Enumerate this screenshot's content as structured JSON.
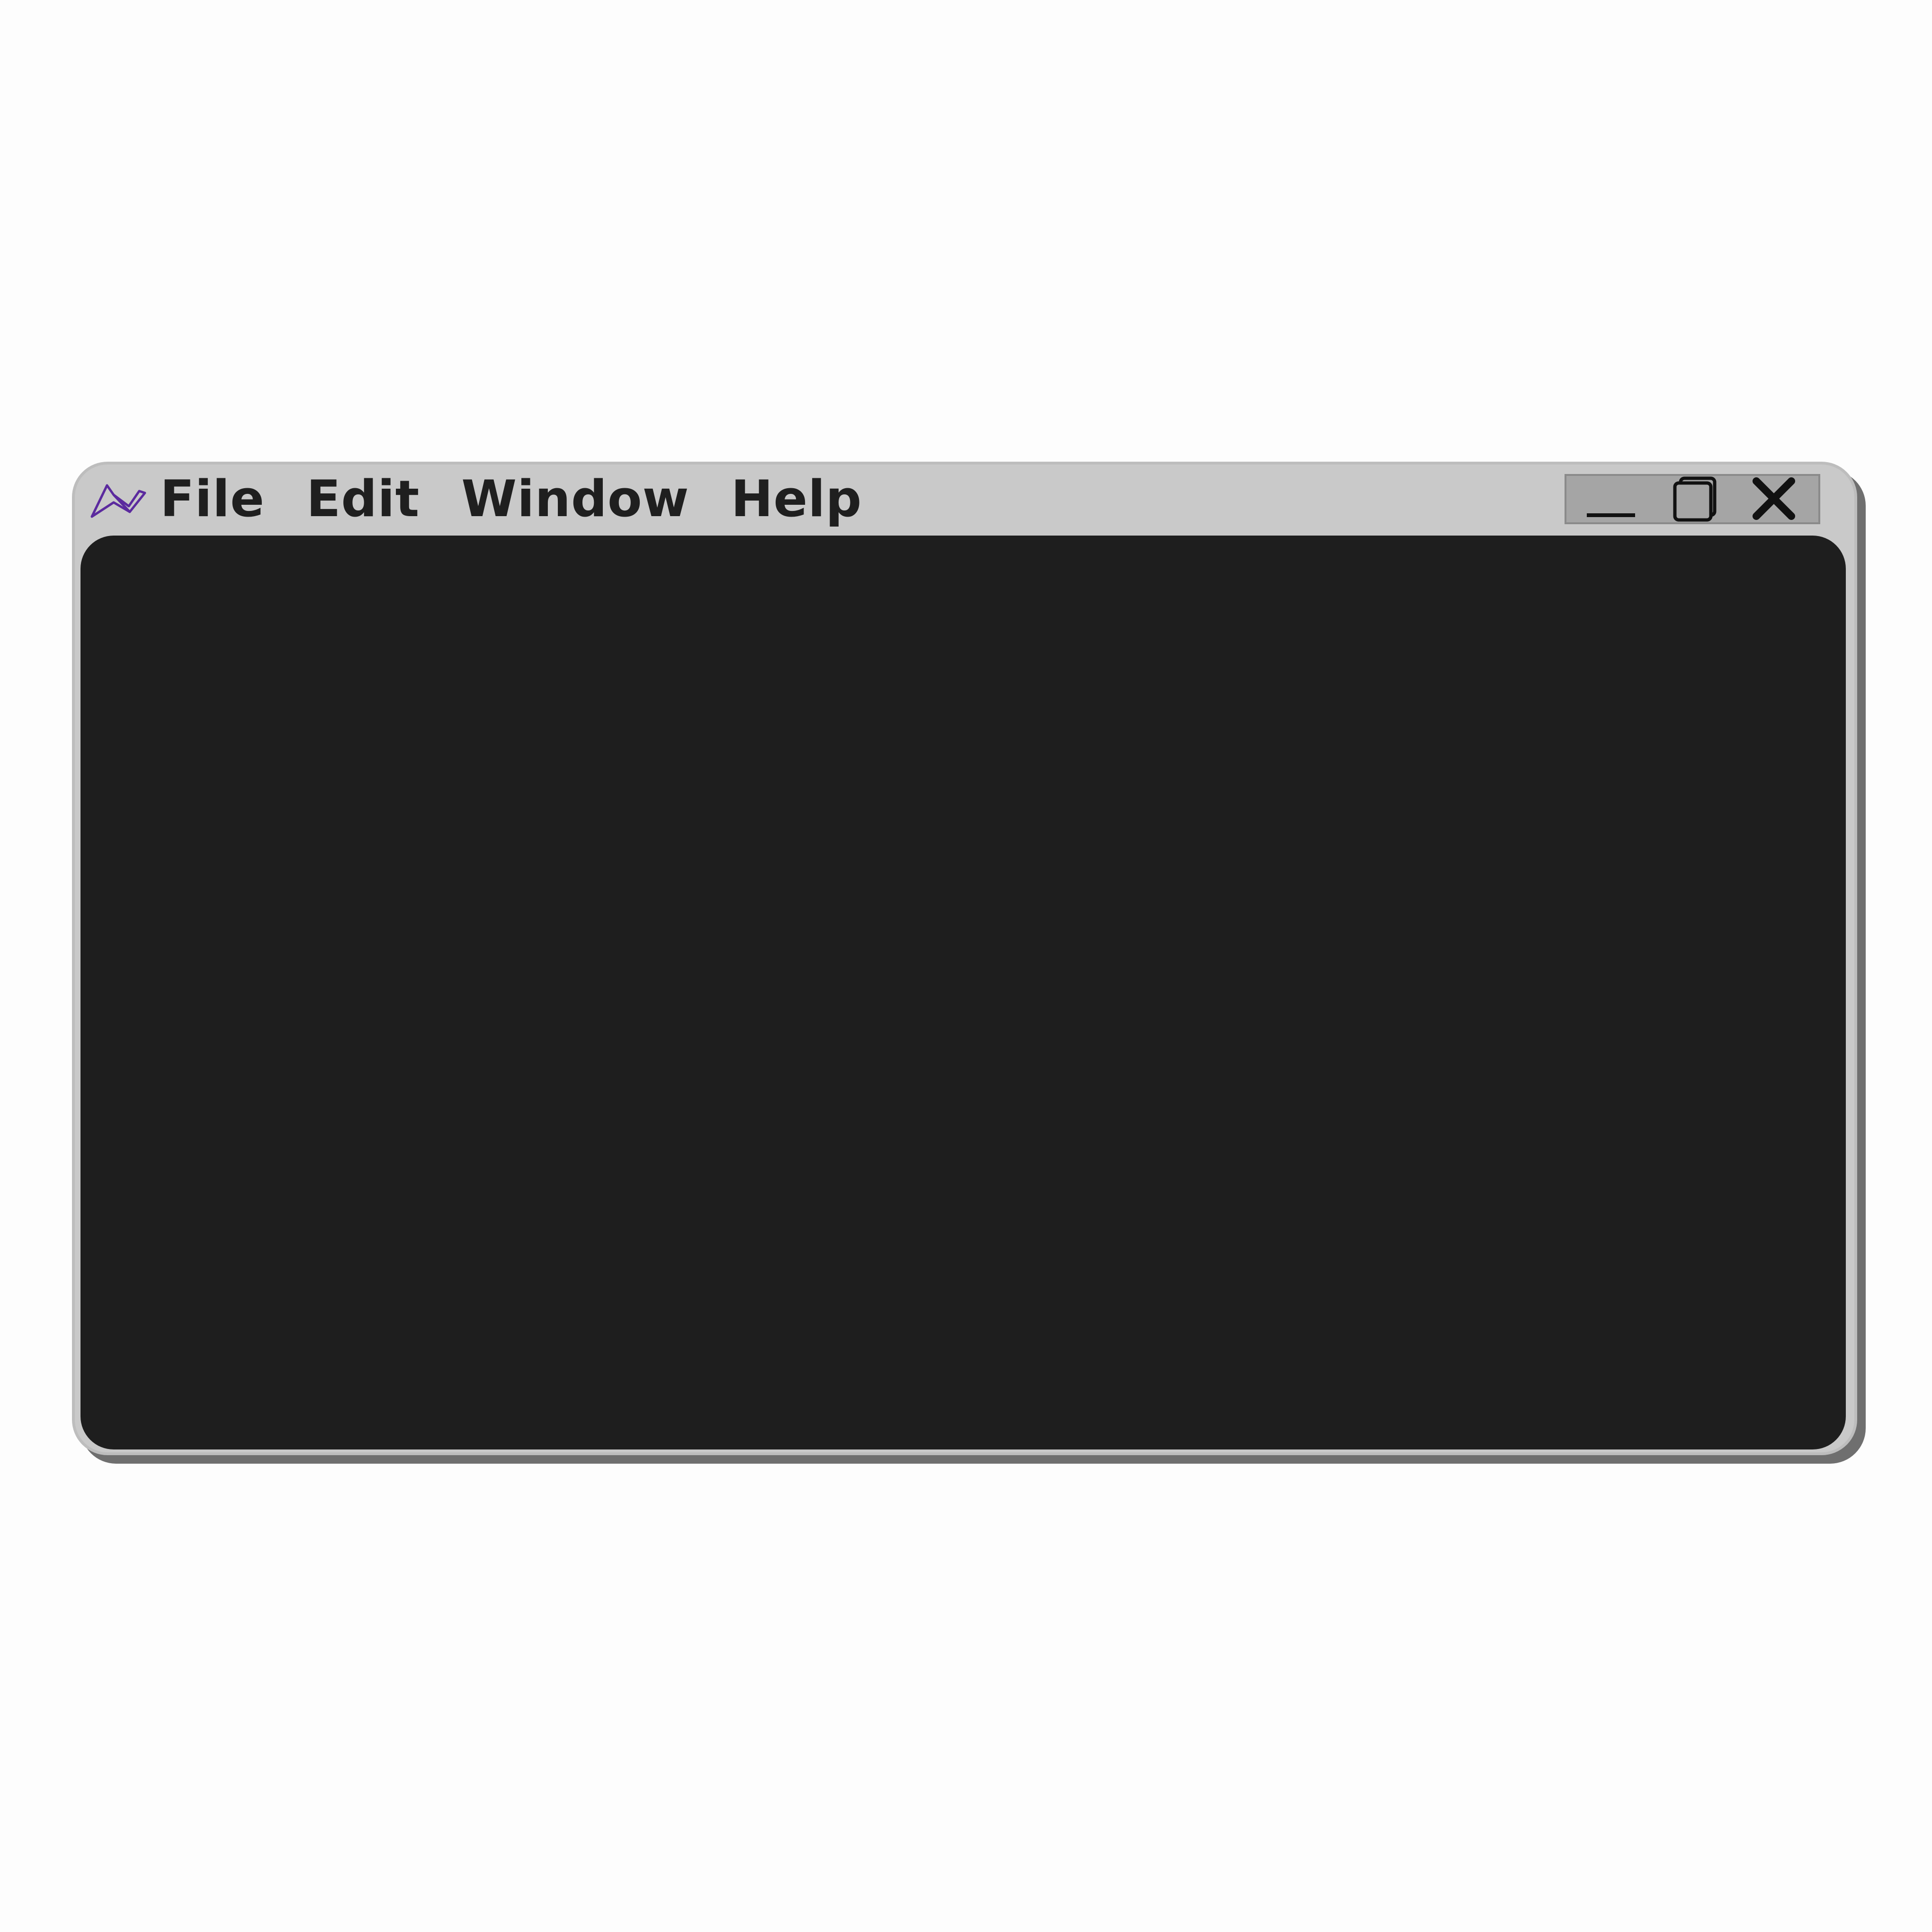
{
  "window": {
    "menu": [
      "File",
      "Edit",
      "Window",
      "Help"
    ],
    "controls": {
      "minimize_icon": "minimize-icon",
      "maximize_icon": "restore-icon",
      "close_icon": "close-icon"
    },
    "logo_icon": "app-logo-icon"
  },
  "colors": {
    "frame": "#c9c9c9",
    "content": "#1e1e1e",
    "logo": "#5b2a9e",
    "controls_bg": "#a5a5a5"
  }
}
